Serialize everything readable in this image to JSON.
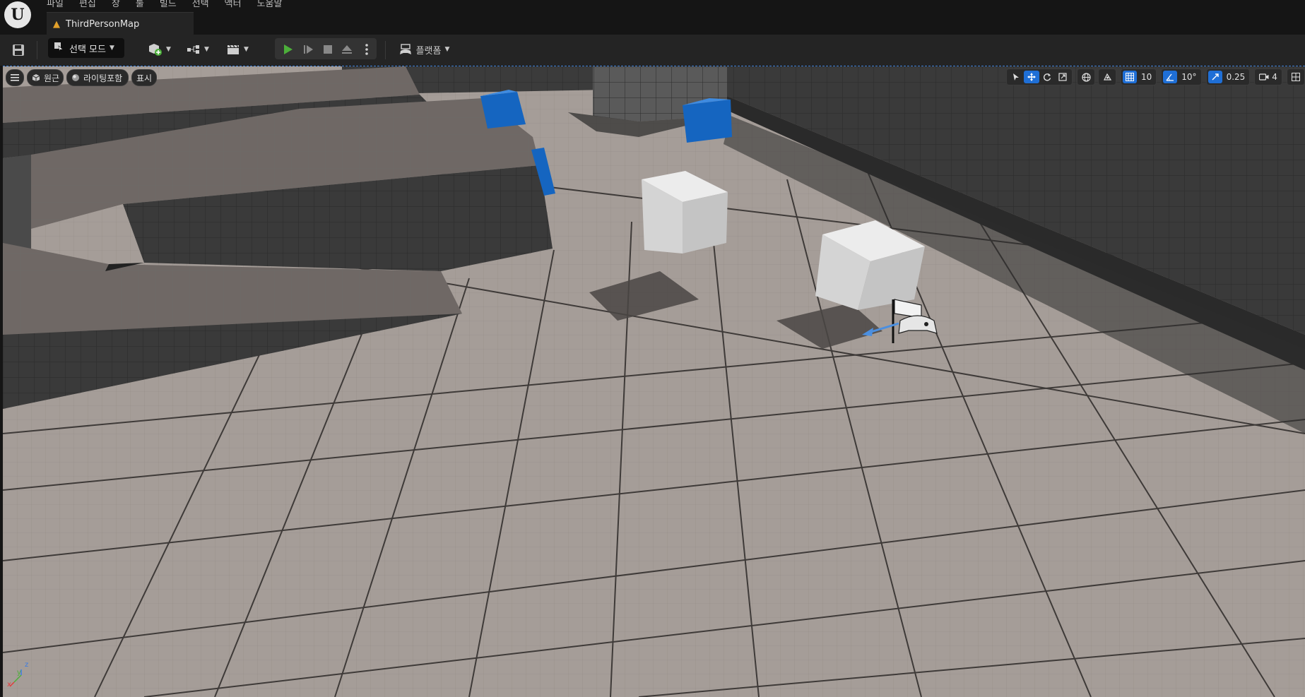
{
  "menu": {
    "items": [
      "파일",
      "편집",
      "창",
      "툴",
      "빌드",
      "선택",
      "액터",
      "도움말"
    ]
  },
  "tab": {
    "title": "ThirdPersonMap"
  },
  "toolbar": {
    "mode_label": "선택 모드",
    "platform_label": "플랫폼"
  },
  "viewport": {
    "perspective_label": "원근",
    "lighting_label": "라이팅포함",
    "show_label": "표시",
    "grid_snap_value": "10",
    "rotation_snap_value": "10°",
    "scale_snap_value": "0.25",
    "camera_speed_value": "4",
    "axis_labels": {
      "x": "x",
      "y": "y",
      "z": "z"
    }
  },
  "colors": {
    "accent": "#1f6fd6",
    "play_green": "#4caf3a",
    "cube_blue": "#1565c0",
    "floor": "#a59d98",
    "tab_icon": "#e2a02a"
  }
}
